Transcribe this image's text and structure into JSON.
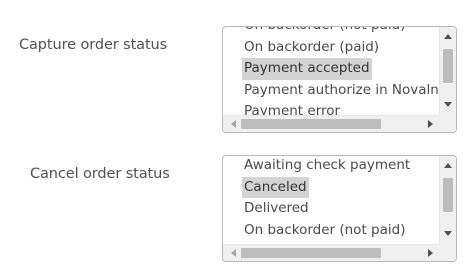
{
  "capture": {
    "label": "Capture order status",
    "options": [
      {
        "label": "On backorder (not paid)",
        "selected": false
      },
      {
        "label": "On backorder (paid)",
        "selected": false
      },
      {
        "label": "Payment accepted",
        "selected": true
      },
      {
        "label": "Payment authorize in Novalnet",
        "selected": false
      },
      {
        "label": "Payment error",
        "selected": false
      }
    ]
  },
  "cancel": {
    "label": "Cancel order status",
    "options": [
      {
        "label": "Awaiting check payment",
        "selected": false
      },
      {
        "label": "Canceled",
        "selected": true
      },
      {
        "label": "Delivered",
        "selected": false
      },
      {
        "label": "On backorder (not paid)",
        "selected": false
      }
    ]
  },
  "icons": {
    "scroll_up": "triangle-up-icon",
    "scroll_down": "triangle-down-icon",
    "scroll_left": "triangle-left-icon",
    "scroll_right": "triangle-right-icon"
  }
}
